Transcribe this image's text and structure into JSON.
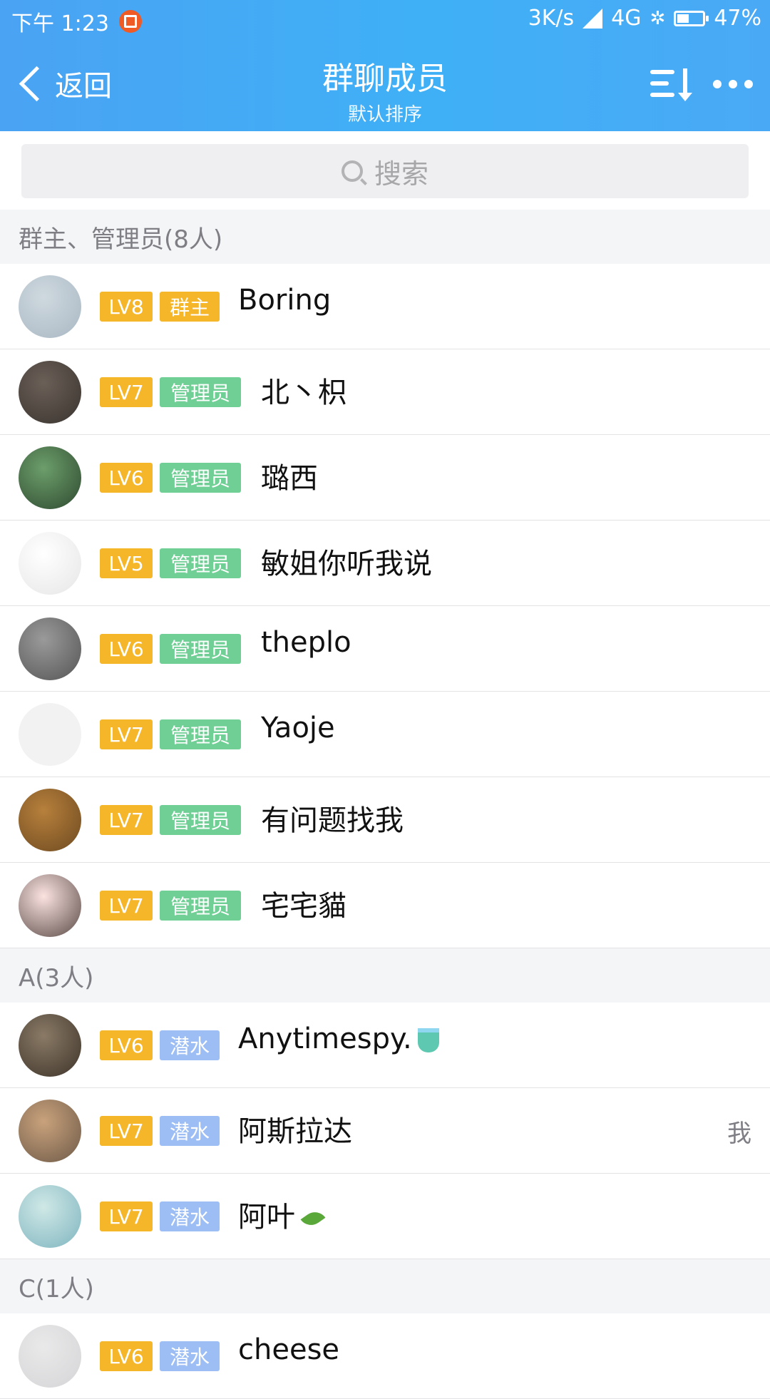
{
  "status_bar": {
    "time": "下午 1:23",
    "speed": "3K/s",
    "network": "4G",
    "battery": "47%",
    "battery_level": 0.47
  },
  "nav": {
    "back_label": "返回",
    "title": "群聊成员",
    "subtitle": "默认排序",
    "icons": [
      "sort-icon",
      "more-icon"
    ]
  },
  "search": {
    "placeholder": "搜索"
  },
  "sections": [
    {
      "header": "群主、管理员(8人)",
      "members": [
        {
          "level": "LV8",
          "role": "群主",
          "role_type": "owner",
          "name": "Boring",
          "avatar_colors": [
            "#cfd9df",
            "#a9b8c4"
          ]
        },
        {
          "level": "LV7",
          "role": "管理员",
          "role_type": "admin",
          "name": "北丶枳",
          "avatar_colors": [
            "#6b6058",
            "#3a332e"
          ]
        },
        {
          "level": "LV6",
          "role": "管理员",
          "role_type": "admin",
          "name": "璐西",
          "avatar_colors": [
            "#6c9e6b",
            "#2f4a30"
          ]
        },
        {
          "level": "LV5",
          "role": "管理员",
          "role_type": "admin",
          "name": "敏姐你听我说",
          "avatar_colors": [
            "#ffffff",
            "#e6e6e6"
          ]
        },
        {
          "level": "LV6",
          "role": "管理员",
          "role_type": "admin",
          "name": "theplo",
          "avatar_colors": [
            "#9a9a9a",
            "#555555"
          ]
        },
        {
          "level": "LV7",
          "role": "管理员",
          "role_type": "admin",
          "name": "Yaoje",
          "avatar_colors": [
            "#f2f2f2",
            "#f2f2f2"
          ]
        },
        {
          "level": "LV7",
          "role": "管理员",
          "role_type": "admin",
          "name": "有问题找我",
          "avatar_colors": [
            "#b7803c",
            "#6e4a20"
          ]
        },
        {
          "level": "LV7",
          "role": "管理员",
          "role_type": "admin",
          "name": "宅宅貓",
          "avatar_colors": [
            "#fbe3e0",
            "#5a4a47"
          ]
        }
      ]
    },
    {
      "header": "A(3人)",
      "members": [
        {
          "level": "LV6",
          "role": "潜水",
          "role_type": "dive",
          "name": "Anytimespy.",
          "suffix": "teacup",
          "avatar_colors": [
            "#8a7a66",
            "#3e342a"
          ]
        },
        {
          "level": "LV7",
          "role": "潜水",
          "role_type": "dive",
          "name": "阿斯拉达",
          "me": "我",
          "avatar_colors": [
            "#c9a27c",
            "#6e5a48"
          ]
        },
        {
          "level": "LV7",
          "role": "潜水",
          "role_type": "dive",
          "name": "阿叶",
          "suffix": "leaf",
          "avatar_colors": [
            "#cfe8e6",
            "#7fb5c0"
          ]
        }
      ]
    },
    {
      "header": "C(1人)",
      "members": [
        {
          "level": "LV6",
          "role": "潜水",
          "role_type": "dive",
          "name": "cheese",
          "avatar_colors": [
            "#e9e9ea",
            "#d5d5d7"
          ]
        }
      ]
    }
  ]
}
